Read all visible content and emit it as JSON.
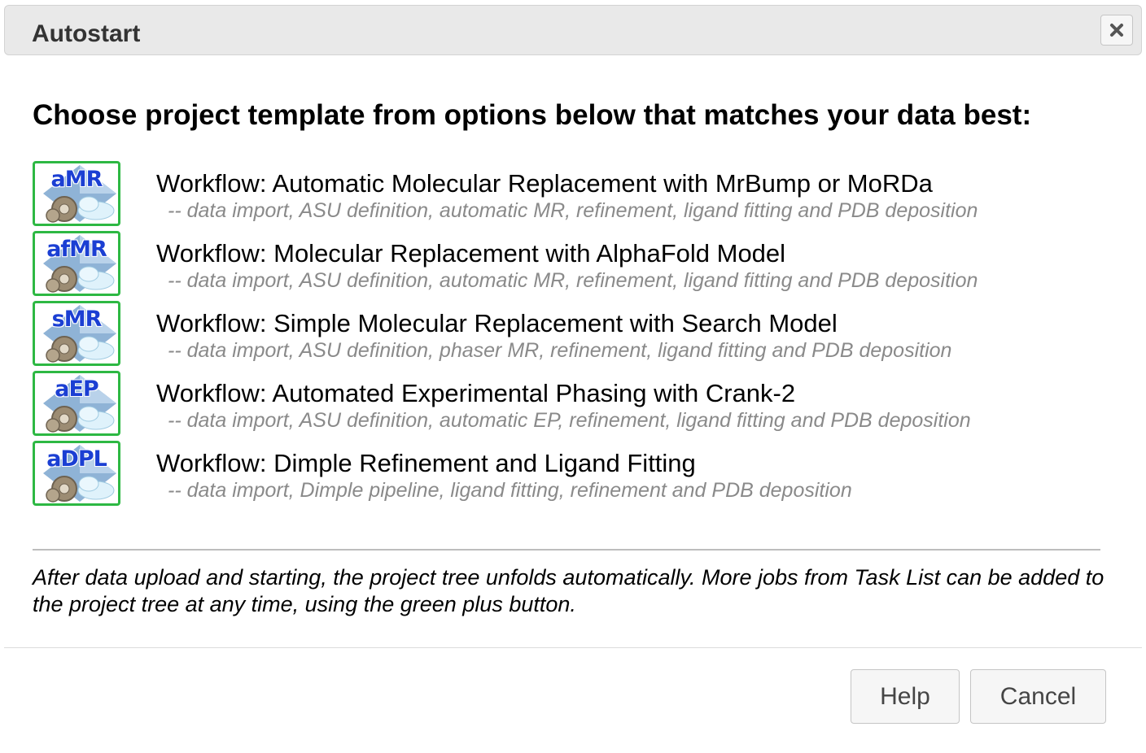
{
  "dialog": {
    "title": "Autostart",
    "close_icon": "close-icon",
    "heading": "Choose project template from options below that matches your data best:"
  },
  "workflows": [
    {
      "icon_label": "aMR",
      "title": "Workflow: Automatic Molecular Replacement with MrBump or MoRDa",
      "description": "-- data import, ASU definition, automatic MR, refinement, ligand fitting and PDB deposition"
    },
    {
      "icon_label": "afMR",
      "title": "Workflow: Molecular Replacement with AlphaFold Model",
      "description": "-- data import, ASU definition, automatic MR, refinement, ligand fitting and PDB deposition"
    },
    {
      "icon_label": "sMR",
      "title": "Workflow: Simple Molecular Replacement with Search Model",
      "description": "-- data import, ASU definition, phaser MR, refinement, ligand fitting and PDB deposition"
    },
    {
      "icon_label": "aEP",
      "title": "Workflow: Automated Experimental Phasing with Crank-2",
      "description": "-- data import, ASU definition, automatic EP, refinement, ligand fitting and PDB deposition"
    },
    {
      "icon_label": "aDPL",
      "title": "Workflow: Dimple Refinement and Ligand Fitting",
      "description": "-- data import, Dimple pipeline, ligand fitting, refinement and PDB deposition"
    }
  ],
  "note": "After data upload and starting, the project tree unfolds automatically. More jobs from Task List can be added to the project tree at any time, using the green plus button.",
  "buttons": {
    "help": "Help",
    "cancel": "Cancel"
  },
  "colors": {
    "icon_border": "#2db843",
    "icon_label": "#1b3fd3",
    "description": "#8a8a8a"
  }
}
